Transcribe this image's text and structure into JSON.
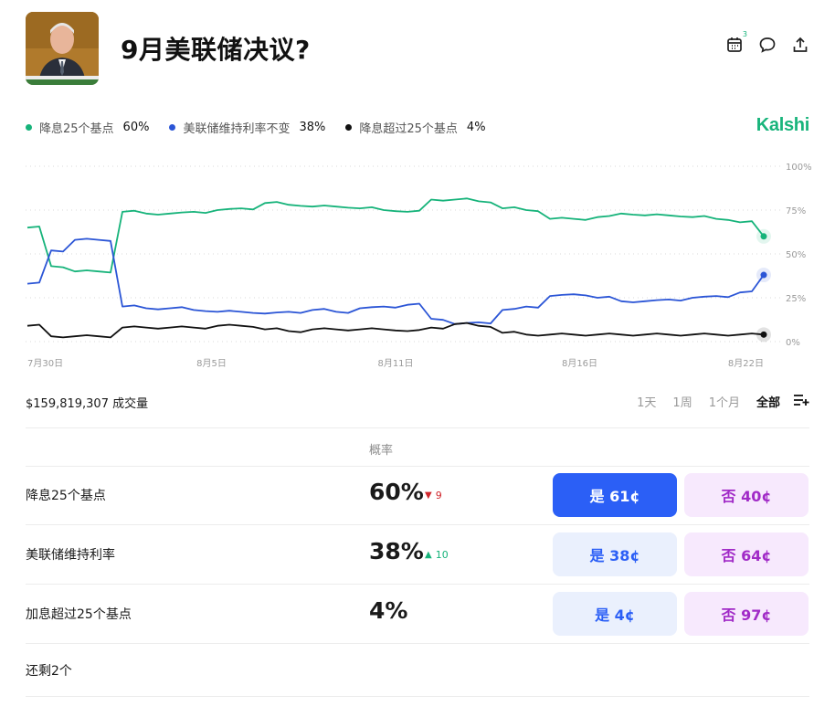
{
  "header": {
    "title": "9月美联储决议?",
    "calendar_badge": "3"
  },
  "brand": "Kalshi",
  "legend": [
    {
      "label": "降息25个基点",
      "value": "60%",
      "color": "#16b37a"
    },
    {
      "label": "美联储维持利率不变",
      "value": "38%",
      "color": "#2b55d6"
    },
    {
      "label": "降息超过25个基点",
      "value": "4%",
      "color": "#111111"
    }
  ],
  "chart_data": {
    "type": "line",
    "x_tick_labels": [
      "7月30日",
      "8月5日",
      "8月11日",
      "8月16日",
      "8月22日"
    ],
    "y_tick_labels": [
      "100%",
      "75%",
      "50%",
      "25%",
      "0%"
    ],
    "ylim": [
      0,
      100
    ],
    "grid": true,
    "series": [
      {
        "name": "降息25个基点",
        "color": "#16b37a",
        "values": [
          65,
          43,
          40,
          40,
          74,
          73,
          73,
          74,
          75,
          76,
          79,
          78,
          77,
          77,
          76,
          75,
          74,
          81,
          81,
          80,
          76,
          75,
          70,
          70,
          71,
          73,
          72,
          72,
          71,
          70,
          68,
          60
        ]
      },
      {
        "name": "美联储维持利率不变",
        "color": "#2b55d6",
        "values": [
          33,
          52,
          58,
          58,
          20,
          19,
          19,
          18,
          17,
          17,
          16,
          17,
          18,
          17,
          19,
          20,
          21,
          13,
          10,
          11,
          18,
          20,
          26,
          27,
          25,
          23,
          23,
          24,
          25,
          26,
          28,
          38
        ]
      },
      {
        "name": "降息超过25个基点",
        "color": "#111111",
        "values": [
          9,
          3,
          3,
          3,
          8,
          8,
          8,
          8,
          9,
          9,
          7,
          6,
          7,
          7,
          7,
          7,
          6,
          8,
          10,
          9,
          5,
          4,
          4,
          4,
          4,
          4,
          4,
          4,
          4,
          4,
          4,
          4
        ]
      }
    ]
  },
  "volume": "$159,819,307 成交量",
  "ranges": [
    "1天",
    "1周",
    "1个月",
    "全部"
  ],
  "active_range": "全部",
  "table": {
    "col_header": "概率",
    "rows": [
      {
        "label": "降息25个基点",
        "pct": "60%",
        "change": "9",
        "dir": "down",
        "yes": "是 61¢",
        "no": "否 40¢",
        "yes_style": "solid"
      },
      {
        "label": "美联储维持利率",
        "pct": "38%",
        "change": "10",
        "dir": "up",
        "yes": "是 38¢",
        "no": "否 64¢",
        "yes_style": "soft"
      },
      {
        "label": "加息超过25个基点",
        "pct": "4%",
        "change": "",
        "dir": "",
        "yes": "是 4¢",
        "no": "否 97¢",
        "yes_style": "soft"
      }
    ]
  },
  "more_label": "还剩2个"
}
